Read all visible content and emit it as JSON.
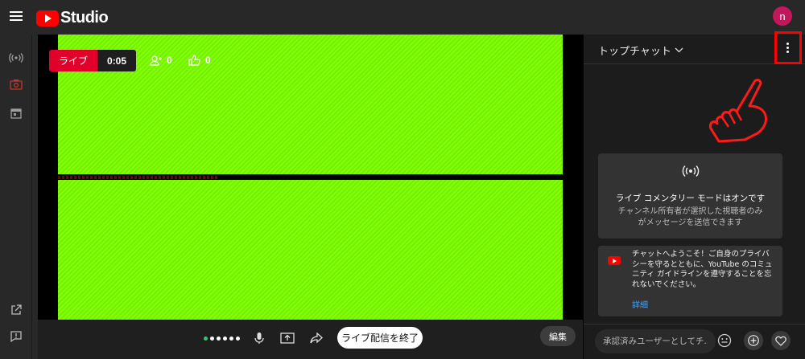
{
  "header": {
    "app_name": "Studio",
    "avatar_letter": "n",
    "avatar_color": "#c2185b",
    "icons": [
      "menu-icon",
      "youtube-logo-icon"
    ]
  },
  "rail": {
    "icons": [
      "broadcast-icon",
      "camera-icon",
      "calendar-icon",
      "external-link-icon",
      "feedback-icon"
    ]
  },
  "stage": {
    "live_label": "ライブ",
    "elapsed": "0:05",
    "viewers": "0",
    "likes": "0",
    "video_color": "#7cff00"
  },
  "controls": {
    "end_stream_label": "ライブ配信を終了",
    "edit_label": "編集",
    "icons": [
      "mic-icon",
      "share-screen-icon",
      "share-icon"
    ]
  },
  "chat": {
    "title": "トップチャット",
    "commentary_title": "ライブ コメンタリー モードはオンです",
    "commentary_body": "チャンネル所有者が選択した視聴者のみがメッセージを送信できます",
    "welcome_message": "チャットへようこそ！ご自身のプライバシーを守るとともに、YouTube のコミュニティ ガイドラインを遵守することを忘れないでください。",
    "details_link": "詳細",
    "input_placeholder": "承認済みユーザーとしてチ...",
    "accent_color": "#ff0000"
  }
}
